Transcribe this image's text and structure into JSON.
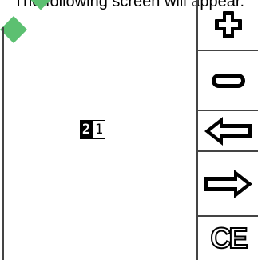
{
  "header": {
    "text": "The following screen will appear."
  },
  "code_display": {
    "digits": [
      "2",
      "1"
    ],
    "active_digit_index": 0
  },
  "side_panel": {
    "buttons": [
      {
        "name": "plus",
        "icon": "plus-icon"
      },
      {
        "name": "minus",
        "icon": "minus-icon"
      },
      {
        "name": "left",
        "icon": "arrow-left-icon"
      },
      {
        "name": "right",
        "icon": "arrow-right-icon"
      },
      {
        "name": "clear",
        "icon": "ce-icon",
        "label": "CE"
      }
    ]
  },
  "colors": {
    "decoration": "#5cc071",
    "line": "#444444",
    "icon_stroke": "#000000",
    "icon_fill": "#ffffff"
  }
}
